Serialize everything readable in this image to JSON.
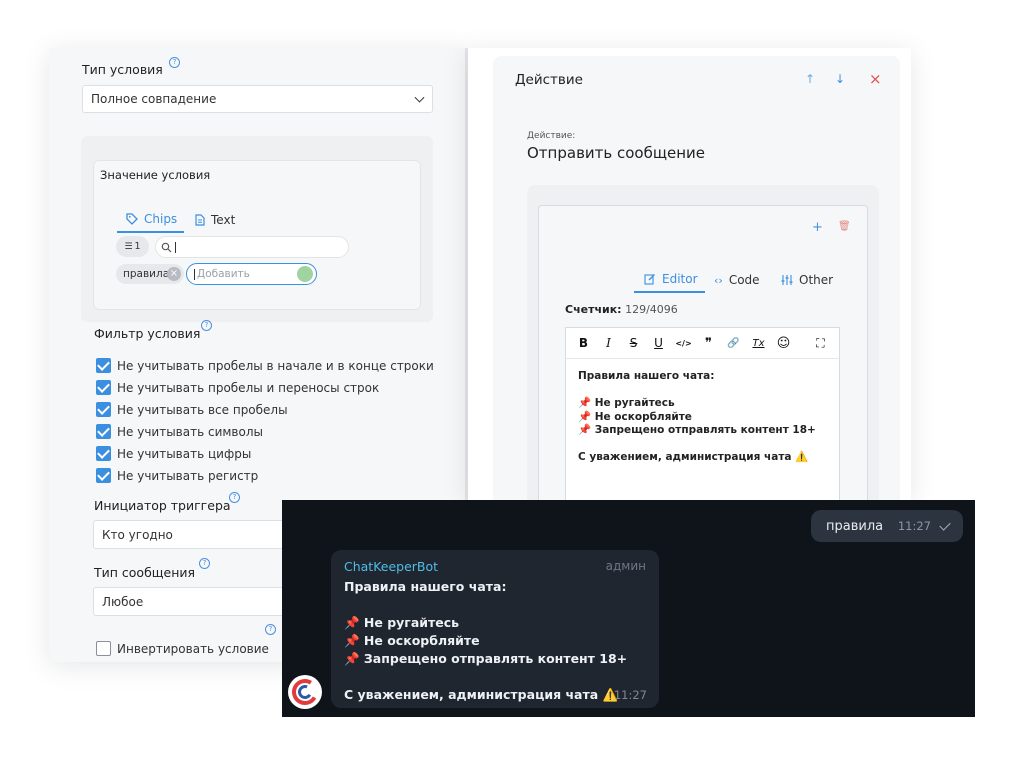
{
  "left": {
    "condition_type": {
      "label": "Тип условия",
      "value": "Полное совпадение"
    },
    "condition_value": {
      "title": "Значение условия",
      "tabs": [
        {
          "label": "Chips"
        },
        {
          "label": "Text"
        }
      ],
      "count": "1",
      "chips": [
        "правила"
      ],
      "add_placeholder": "Добавить"
    },
    "filter": {
      "title": "Фильтр условия",
      "options": [
        {
          "label": "Не учитывать пробелы в начале и в конце строки",
          "checked": true
        },
        {
          "label": "Не учитывать пробелы и переносы строк",
          "checked": true
        },
        {
          "label": "Не учитывать все пробелы",
          "checked": true
        },
        {
          "label": "Не учитывать символы",
          "checked": true
        },
        {
          "label": "Не учитывать цифры",
          "checked": true
        },
        {
          "label": "Не учитывать регистр",
          "checked": true
        }
      ]
    },
    "initiator": {
      "label": "Инициатор триггера",
      "value": "Кто угодно"
    },
    "message_type": {
      "label": "Тип сообщения",
      "value": "Любое"
    },
    "invert": {
      "label": "Инвертировать условие",
      "checked": false
    }
  },
  "right": {
    "header": {
      "title": "Действие",
      "up": "↑",
      "down": "↓",
      "close": "×"
    },
    "action": {
      "caption": "Действие:",
      "name": "Отправить сообщение"
    },
    "card": {
      "add": "+",
      "delete": "🗑"
    },
    "tabs": [
      {
        "label": "Editor"
      },
      {
        "label": "Code"
      },
      {
        "label": "Other"
      }
    ],
    "counter": {
      "label": "Счетчик:",
      "value": "129/4096"
    },
    "toolbar": [
      {
        "glyph": "B",
        "icon": "bold-icon"
      },
      {
        "glyph": "I",
        "icon": "italic-icon"
      },
      {
        "glyph": "S",
        "icon": "strikethrough-icon"
      },
      {
        "glyph": "U",
        "icon": "underline-icon"
      },
      {
        "glyph": "</>",
        "icon": "code-icon"
      },
      {
        "glyph": "❞",
        "icon": "quote-icon"
      },
      {
        "glyph": "🔗",
        "icon": "link-icon"
      },
      {
        "glyph": "Tx",
        "icon": "clear-format-icon"
      },
      {
        "glyph": "☺",
        "icon": "emoji-icon"
      },
      {
        "glyph": "⛶",
        "icon": "fullscreen-icon"
      }
    ],
    "editor": {
      "lines": [
        "Правила нашего чата:",
        "",
        "📌 Не ругайтесь",
        "📌 Не оскорбляйте",
        "📌 Запрещено отправлять контент 18+",
        "",
        "С уважением, администрация чата ⚠️"
      ]
    }
  },
  "chat": {
    "outgoing": {
      "text": "правила",
      "time": "11:27"
    },
    "incoming": {
      "sender": "ChatKeeperBot",
      "role": "админ",
      "lines": [
        "Правила нашего чата:",
        "",
        "📌 Не ругайтесь",
        "📌 Не оскорбляйте",
        "📌 Запрещено отправлять контент 18+",
        "",
        "С уважением, администрация чата ⚠️"
      ],
      "time": "11:27"
    }
  }
}
